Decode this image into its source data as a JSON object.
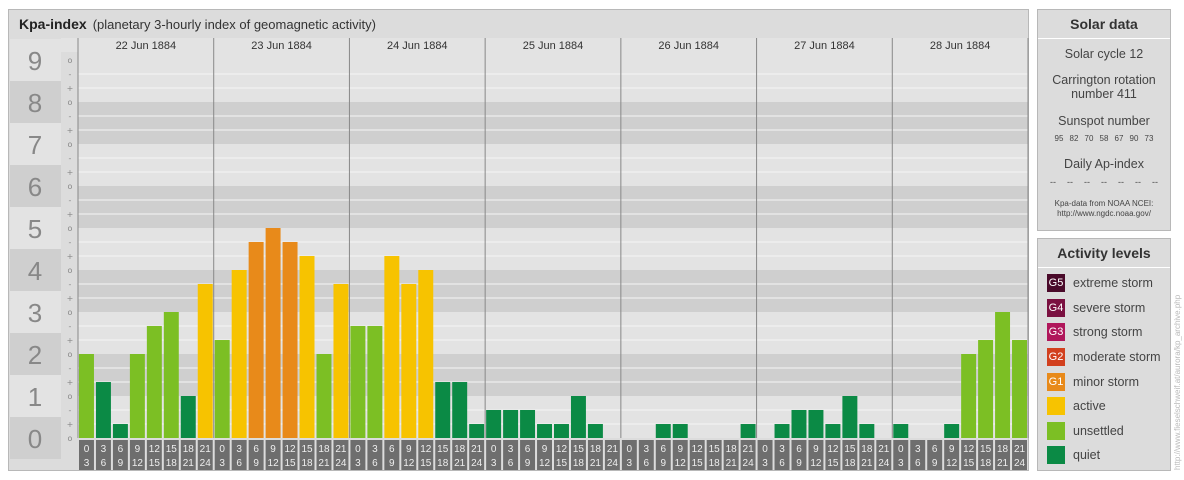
{
  "title": {
    "main": "Kpa-index",
    "sub": "(planetary 3-hourly index of geomagnetic activity)"
  },
  "chart_data": {
    "type": "bar",
    "days": [
      "22 Jun 1884",
      "23 Jun 1884",
      "24 Jun 1884",
      "25 Jun 1884",
      "26 Jun 1884",
      "27 Jun 1884",
      "28 Jun 1884"
    ],
    "interval_labels": [
      [
        "0",
        "3"
      ],
      [
        "3",
        "6"
      ],
      [
        "6",
        "9"
      ],
      [
        "9",
        "12"
      ],
      [
        "12",
        "15"
      ],
      [
        "15",
        "18"
      ],
      [
        "18",
        "21"
      ],
      [
        "21",
        "24"
      ]
    ],
    "y_ticks": [
      "0",
      "1",
      "2",
      "3",
      "4",
      "5",
      "6",
      "7",
      "8",
      "9"
    ],
    "sub_ticks": [
      "+",
      "o",
      "-"
    ],
    "ylim": [
      0,
      9
    ],
    "values": [
      2,
      1.333,
      0.333,
      2,
      2.667,
      3,
      1,
      3.667,
      2.333,
      4,
      4.667,
      5,
      4.667,
      4.333,
      2,
      3.667,
      2.667,
      2.667,
      4.333,
      3.667,
      4,
      1.333,
      1.333,
      0.333,
      0.667,
      0.667,
      0.667,
      0.333,
      0.333,
      1,
      0.333,
      0,
      0,
      0,
      0.333,
      0.333,
      0,
      0,
      0,
      0.333,
      0,
      0.333,
      0.667,
      0.667,
      0.333,
      1,
      0.333,
      0,
      0.333,
      0,
      0,
      0.333,
      2,
      2.333,
      3,
      2.333
    ],
    "level_colors": {
      "quiet": "#0b8a45",
      "unsettled": "#7cbf24",
      "active": "#f7c300",
      "minor": "#e88a1a"
    }
  },
  "solar": {
    "heading": "Solar data",
    "cycle": "Solar cycle 12",
    "carrington": "Carrington rotation number 411",
    "sunspot_label": "Sunspot number",
    "sunspots": [
      "95",
      "82",
      "70",
      "58",
      "67",
      "90",
      "73"
    ],
    "ap_label": "Daily Ap-index",
    "ap_values": [
      "--",
      "--",
      "--",
      "--",
      "--",
      "--",
      "--"
    ],
    "source_line1": "Kpa-data from NOAA NCEI:",
    "source_line2": "http://www.ngdc.noaa.gov/"
  },
  "levels": {
    "heading": "Activity levels",
    "items": [
      {
        "code": "G5",
        "label": "extreme storm",
        "color": "#4a0a2a"
      },
      {
        "code": "G4",
        "label": "severe storm",
        "color": "#7a1040"
      },
      {
        "code": "G3",
        "label": "strong storm",
        "color": "#b0165a"
      },
      {
        "code": "G2",
        "label": "moderate storm",
        "color": "#d2401e"
      },
      {
        "code": "G1",
        "label": "minor storm",
        "color": "#e88a1a"
      },
      {
        "code": "",
        "label": "active",
        "color": "#f7c300"
      },
      {
        "code": "",
        "label": "unsettled",
        "color": "#7cbf24"
      },
      {
        "code": "",
        "label": "quiet",
        "color": "#0b8a45"
      }
    ]
  },
  "credit": "http://www.fieselschweif.at/aurora/kp_archive.php"
}
